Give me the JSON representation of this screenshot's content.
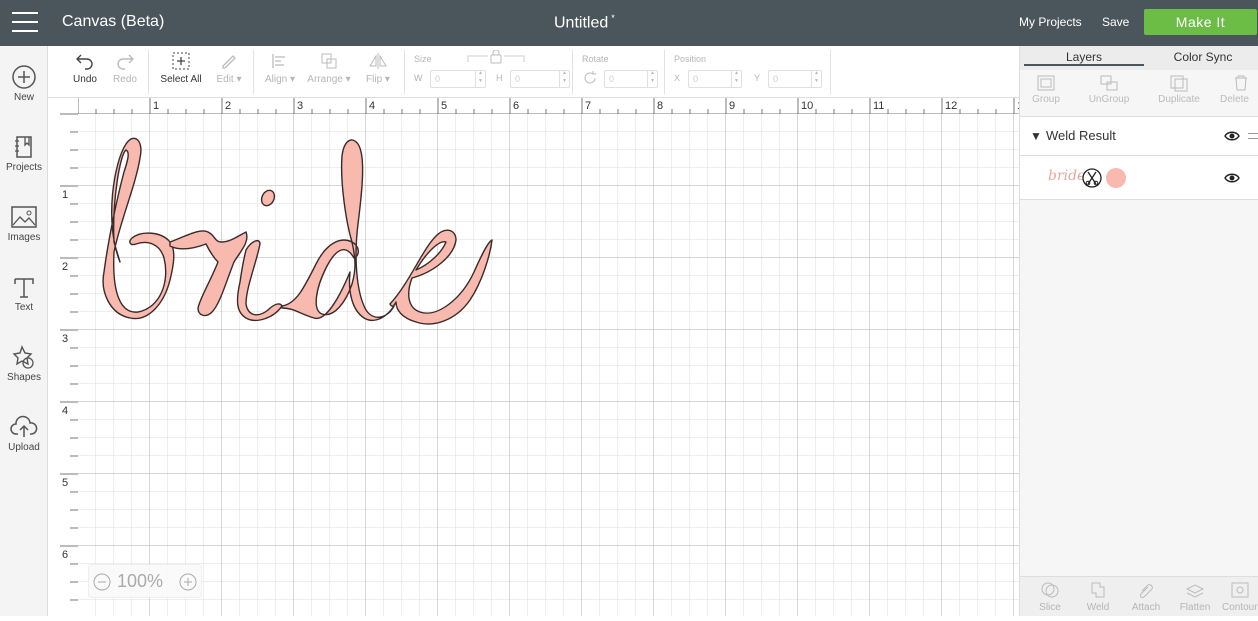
{
  "header": {
    "app_title": "Canvas (Beta)",
    "doc_title": "Untitled",
    "doc_modified_mark": "*",
    "my_projects": "My Projects",
    "save": "Save",
    "make_it": "Make It"
  },
  "left_nav": [
    {
      "label": "New",
      "icon": "plus-circle-icon"
    },
    {
      "label": "Projects",
      "icon": "projects-icon"
    },
    {
      "label": "Images",
      "icon": "image-icon"
    },
    {
      "label": "Text",
      "icon": "text-icon"
    },
    {
      "label": "Shapes",
      "icon": "shapes-icon"
    },
    {
      "label": "Upload",
      "icon": "upload-icon"
    }
  ],
  "toolbar": {
    "undo": "Undo",
    "redo": "Redo",
    "select_all": "Select All",
    "edit": "Edit",
    "align": "Align",
    "arrange": "Arrange",
    "flip": "Flip",
    "size_label": "Size",
    "w_label": "W",
    "h_label": "H",
    "w_value": "0",
    "h_value": "0",
    "rotate_label": "Rotate",
    "rotate_value": "0",
    "position_label": "Position",
    "x_label": "X",
    "y_label": "Y",
    "x_value": "0",
    "y_value": "0"
  },
  "ruler": {
    "top_numbers": [
      "1",
      "2",
      "3",
      "4",
      "5",
      "6",
      "7",
      "8",
      "9",
      "10",
      "11",
      "12",
      "1"
    ],
    "left_numbers": [
      "1",
      "2",
      "3",
      "4",
      "5",
      "6"
    ]
  },
  "canvas": {
    "text": "bride",
    "fill_color": "#f8b9ae",
    "stroke_color": "#3a2a2a"
  },
  "zoom": {
    "value": "100%"
  },
  "right_panel": {
    "tabs": [
      "Layers",
      "Color Sync"
    ],
    "tools": [
      "Group",
      "UnGroup",
      "Duplicate",
      "Delete"
    ],
    "group_name": "Weld Result",
    "layer_thumb_text": "bride",
    "layer_color": "#f8b9ae",
    "bottom_tools": [
      "Slice",
      "Weld",
      "Attach",
      "Flatten",
      "Contour"
    ]
  }
}
